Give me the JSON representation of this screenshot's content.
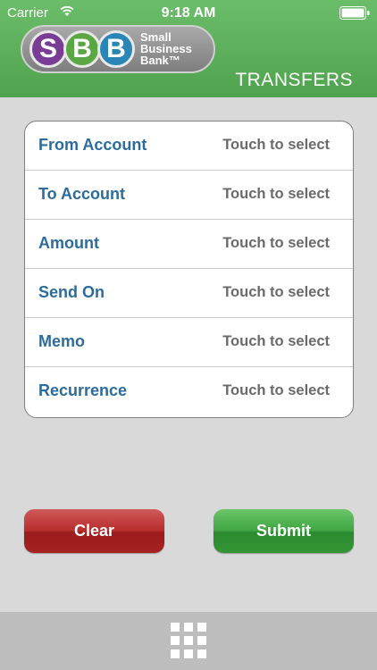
{
  "status_bar": {
    "carrier": "Carrier",
    "time": "9:18 AM"
  },
  "logo": {
    "letters": [
      "S",
      "B",
      "B"
    ],
    "name_line1": "Small",
    "name_line2": "Business",
    "name_line3": "Bank™"
  },
  "header": {
    "title": "TRANSFERS"
  },
  "form": {
    "rows": [
      {
        "label": "From Account",
        "value": "Touch to select"
      },
      {
        "label": "To Account",
        "value": "Touch to select"
      },
      {
        "label": "Amount",
        "value": "Touch to select"
      },
      {
        "label": "Send On",
        "value": "Touch to select"
      },
      {
        "label": "Memo",
        "value": "Touch to select"
      },
      {
        "label": "Recurrence",
        "value": "Touch to select"
      }
    ]
  },
  "buttons": {
    "clear_label": "Clear",
    "submit_label": "Submit"
  },
  "colors": {
    "header_green": "#5aaf58",
    "label_blue": "#2b6c9c",
    "clear_red": "#b72c2c",
    "submit_green": "#3ea541"
  },
  "icons": {
    "menu": "grid-icon"
  }
}
